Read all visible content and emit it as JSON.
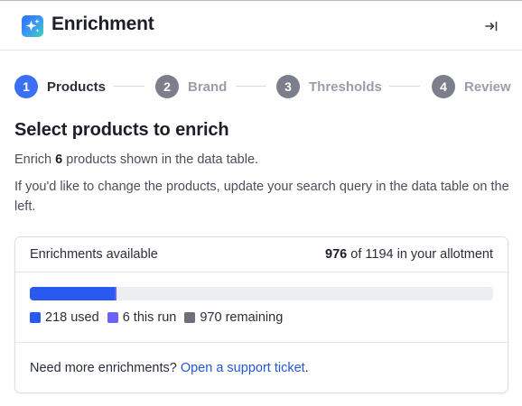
{
  "header": {
    "title": "Enrichment",
    "logo_icon": "sparkles-icon",
    "collapse_icon": "collapse-right-icon"
  },
  "stepper": {
    "steps": [
      {
        "number": "1",
        "label": "Products",
        "active": true
      },
      {
        "number": "2",
        "label": "Brand",
        "active": false
      },
      {
        "number": "3",
        "label": "Thresholds",
        "active": false
      },
      {
        "number": "4",
        "label": "Review",
        "active": false
      }
    ]
  },
  "main": {
    "heading": "Select products to enrich",
    "enrich_prefix": "Enrich",
    "enrich_count": "6",
    "enrich_suffix": "products shown in the data table.",
    "instructions": "If you'd like to change the products, update your search query in the data table on the left."
  },
  "allotment": {
    "header_label": "Enrichments available",
    "available": "976",
    "of_text": "of",
    "total": "1194",
    "suffix": "in your allotment",
    "used": 218,
    "this_run": 6,
    "remaining": 970,
    "legend": [
      {
        "value": "218",
        "label": "used",
        "color": "#2859f0"
      },
      {
        "value": "6",
        "label": "this run",
        "color": "#6b62f7"
      },
      {
        "value": "970",
        "label": "remaining",
        "color": "#6e6f7a"
      }
    ],
    "footer_text": "Need more enrichments?",
    "footer_link": "Open a support ticket",
    "footer_end": "."
  },
  "colors": {
    "accent": "#3b6ff5",
    "inactive_step": "#7b7f8c",
    "link": "#2457d6"
  }
}
